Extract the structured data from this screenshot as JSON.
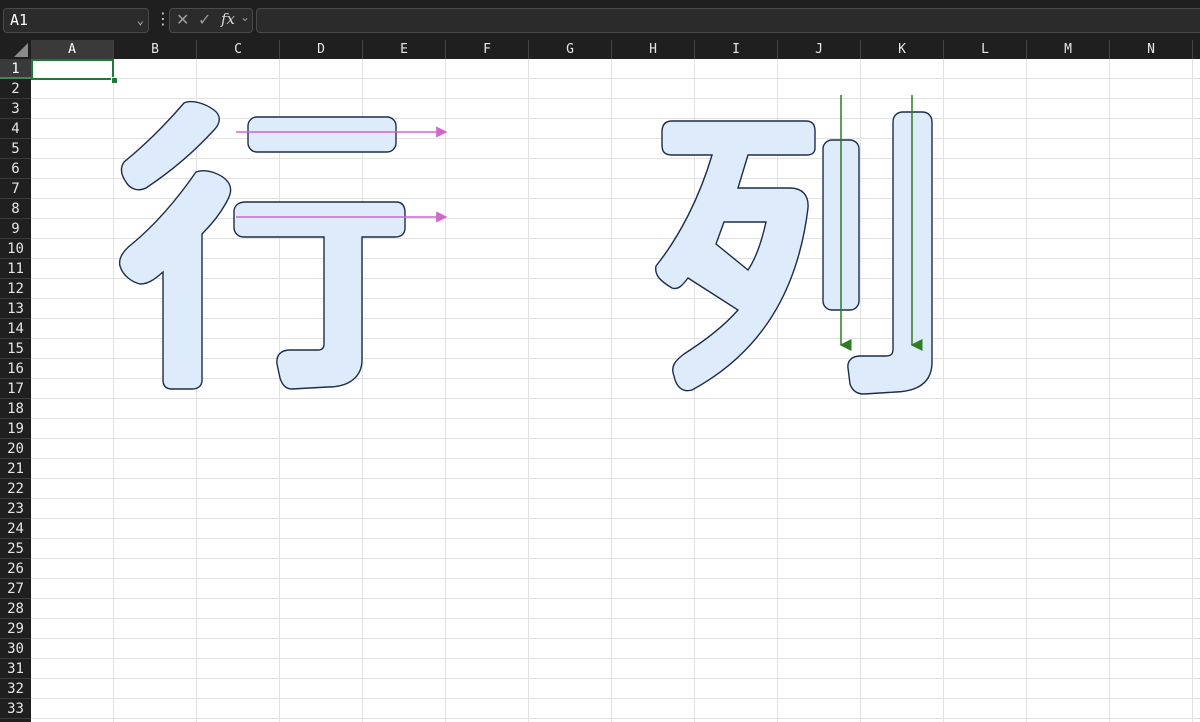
{
  "formula_bar": {
    "name_box": "A1",
    "name_box_chevron": "chevron-down-icon",
    "more_icon": "vertical-ellipsis-icon",
    "cancel_glyph": "✕",
    "enter_glyph": "✓",
    "fx_label": "fx",
    "fx_chevron": "chevron-down-icon",
    "formula_value": ""
  },
  "sheet": {
    "columns": [
      "A",
      "B",
      "C",
      "D",
      "E",
      "F",
      "G",
      "H",
      "I",
      "J",
      "K",
      "L",
      "M",
      "N"
    ],
    "rows": [
      "1",
      "2",
      "3",
      "4",
      "5",
      "6",
      "7",
      "8",
      "9",
      "10",
      "11",
      "12",
      "13",
      "14",
      "15",
      "16",
      "17",
      "18",
      "19",
      "20",
      "21",
      "22",
      "23",
      "24",
      "25",
      "26",
      "27",
      "28",
      "29",
      "30",
      "31",
      "32",
      "33"
    ],
    "selected_cell": "A1"
  },
  "colors": {
    "shape_fill": "#deebfa",
    "shape_stroke": "#1c2d49",
    "row_arrow": "#d066d0",
    "column_arrow": "#2e7d23",
    "selection": "#1f7a3a"
  }
}
